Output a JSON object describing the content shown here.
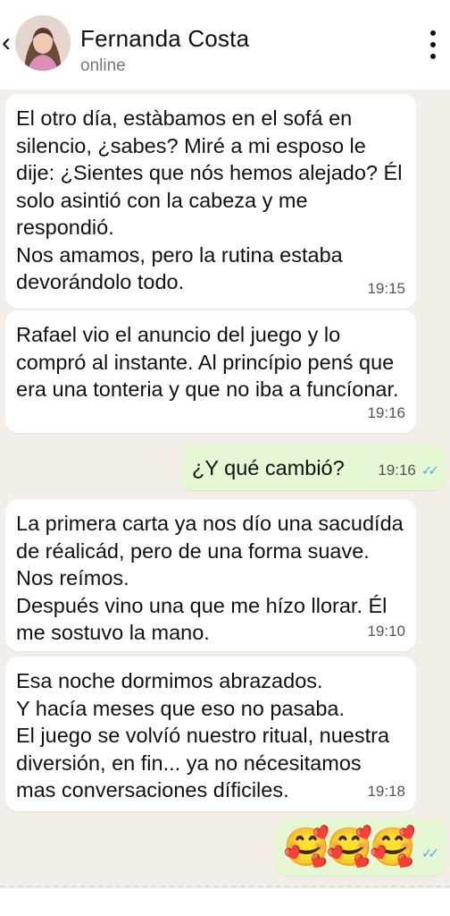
{
  "header": {
    "back_icon": "chevron-left-icon",
    "contact_name": "Fernanda Costa",
    "status": "online",
    "menu_icon": "more-vertical-icon"
  },
  "messages": [
    {
      "direction": "incoming",
      "text": "El otro día, estàbamos en el sofá en silencio, ¿sabes? Miré a mi esposo le dije: ¿Sientes que nós hemos alejado? Él solo asintió con la cabeza y me respondió.\nNos amamos,  pero la rutina estaba devorándolo todo.",
      "time": "19:15"
    },
    {
      "direction": "incoming",
      "text": "Rafael vio el anuncio del juego y lo compró al instante. Al princípio penś que era una tonteria y que no iba a funcíonar.",
      "time": "19:16"
    },
    {
      "direction": "outgoing",
      "text": "¿Y qué cambió?",
      "time": "19:16",
      "ticks": "✓✓"
    },
    {
      "direction": "incoming",
      "text": "La primera carta ya nos dío una sacudída de réalicád, pero de una forma suave. Nos reímos.\nDespués vino una que me hízo llorar. Él me sostuvo la mano.",
      "time": "19:10"
    },
    {
      "direction": "incoming",
      "text": "Esa noche dormimos abrazados.\nY hacía meses que eso no pasaba.\nEl juego se volvíó nuestro ritual, nuestra diversión, en fin... ya no nécesitamos mas conversaciones díficiles.",
      "time": "19:18"
    },
    {
      "direction": "outgoing",
      "text": "🥰🥰🥰",
      "ticks": "✓✓"
    }
  ],
  "colors": {
    "chat_background": "#f3eee8",
    "incoming_bubble": "#ffffff",
    "outgoing_bubble": "#e6f7d4",
    "read_ticks": "#5aa9e6"
  }
}
